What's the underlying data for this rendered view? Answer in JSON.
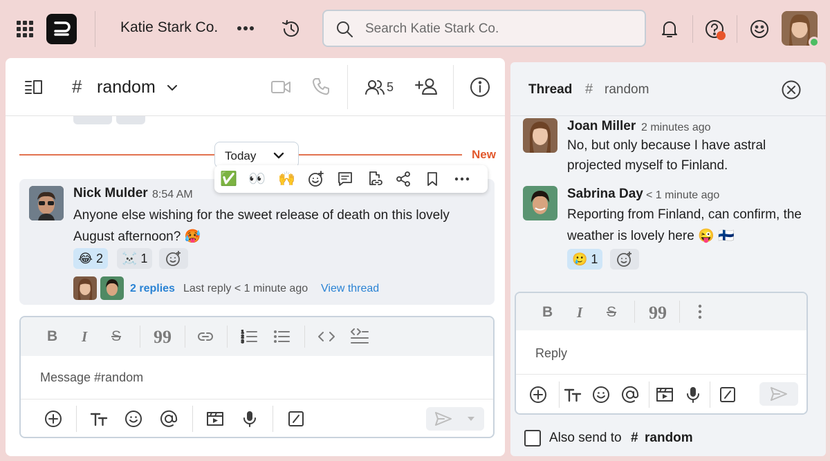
{
  "header": {
    "team_name": "Katie Stark Co.",
    "search_placeholder": "Search Katie Stark Co.",
    "status_dot_color": "#e8542a",
    "online_color": "#4dbd63"
  },
  "channel": {
    "hash": "#",
    "name": "random",
    "member_count": "5"
  },
  "divider": {
    "new_label": "New",
    "date_label": "Today",
    "accent": "#e2724f"
  },
  "hover_toolbar": {
    "quick_reactions": [
      "✅",
      "👀",
      "🙌"
    ]
  },
  "message": {
    "author": "Nick Mulder",
    "time": "8:54 AM",
    "text": "Anyone else wishing for the sweet release of death on this lovely August afternoon? 🥵",
    "reactions": [
      {
        "emoji": "😂",
        "count": "2",
        "active": true
      },
      {
        "emoji": "☠️",
        "count": "1",
        "active": false
      }
    ],
    "replies_link": "2 replies",
    "last_reply": "Last reply < 1 minute ago",
    "view_thread": "View thread",
    "link_color": "#2a83d4"
  },
  "composer": {
    "placeholder": "Message #random"
  },
  "thread": {
    "title": "Thread",
    "hash": "#",
    "channel": "random",
    "messages": [
      {
        "author": "Joan Miller",
        "time": "2 minutes ago",
        "text": "No, but only because I have astral projected myself to Finland."
      },
      {
        "author": "Sabrina Day",
        "time": "< 1 minute ago",
        "text": "Reporting from Finland, can confirm, the weather is lovely here 😜 🇫🇮",
        "reactions": [
          {
            "emoji": "🥲",
            "count": "1",
            "active": true
          }
        ]
      }
    ],
    "reply_placeholder": "Reply",
    "also_send_label": "Also send to",
    "also_send_hash": "#",
    "also_send_channel": "random"
  }
}
